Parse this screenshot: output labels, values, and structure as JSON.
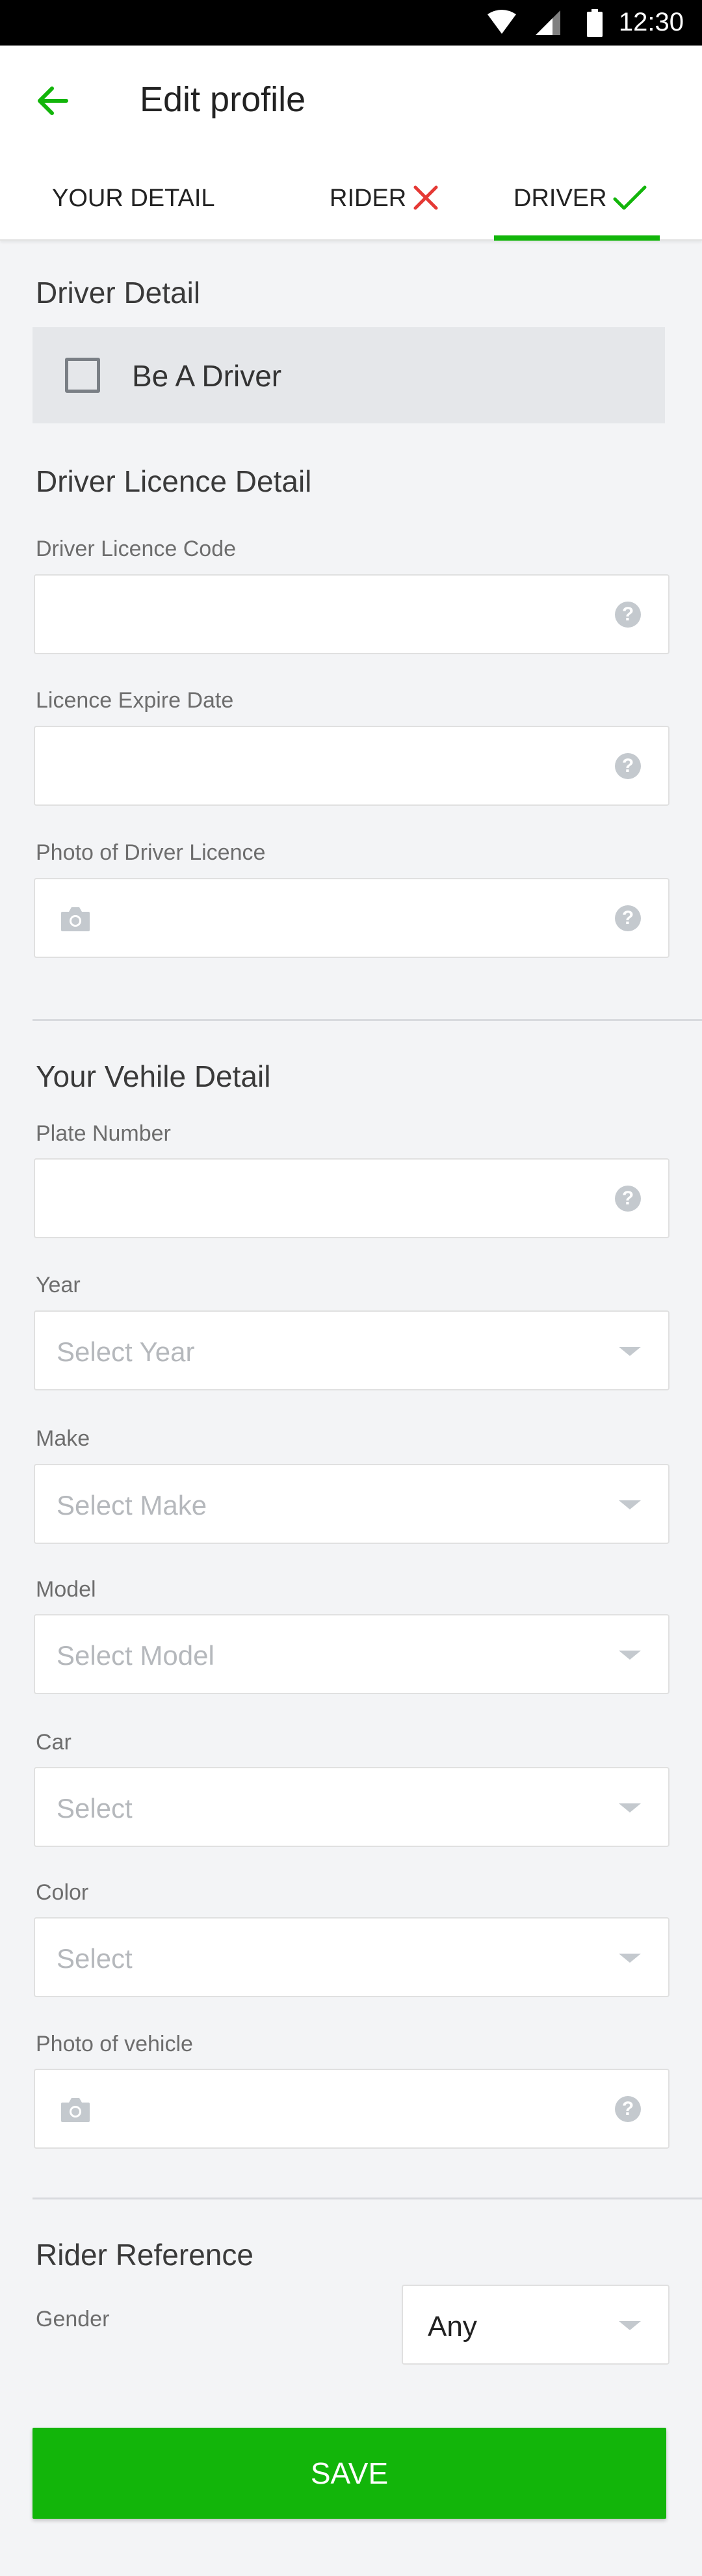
{
  "status_bar": {
    "time": "12:30"
  },
  "app_bar": {
    "title": "Edit profile"
  },
  "tabs": [
    {
      "label": "YOUR DETAIL"
    },
    {
      "label": "RIDER"
    },
    {
      "label": "DRIVER"
    }
  ],
  "driver_detail": {
    "heading": "Driver Detail",
    "be_driver_label": "Be A Driver",
    "be_driver_checked": false
  },
  "licence": {
    "heading": "Driver Licence Detail",
    "code_label": "Driver Licence Code",
    "code_value": "",
    "expire_label": "Licence Expire Date",
    "expire_value": "",
    "photo_label": "Photo of Driver Licence"
  },
  "vehicle": {
    "heading": "Your Vehile Detail",
    "plate_label": "Plate Number",
    "plate_value": "",
    "year_label": "Year",
    "year_placeholder": "Select Year",
    "make_label": "Make",
    "make_placeholder": "Select Make",
    "model_label": "Model",
    "model_placeholder": "Select Model",
    "car_label": "Car",
    "car_placeholder": "Select",
    "color_label": "Color",
    "color_placeholder": "Select",
    "photo_label": "Photo of vehicle"
  },
  "rider_reference": {
    "heading": "Rider Reference",
    "gender_label": "Gender",
    "gender_value": "Any"
  },
  "save_label": "SAVE",
  "colors": {
    "accent": "#12b50a",
    "reject": "#e53935",
    "placeholder": "#b5b8bc"
  },
  "icons": {
    "help": "?",
    "back": "arrow-left-icon",
    "camera": "camera-icon"
  }
}
